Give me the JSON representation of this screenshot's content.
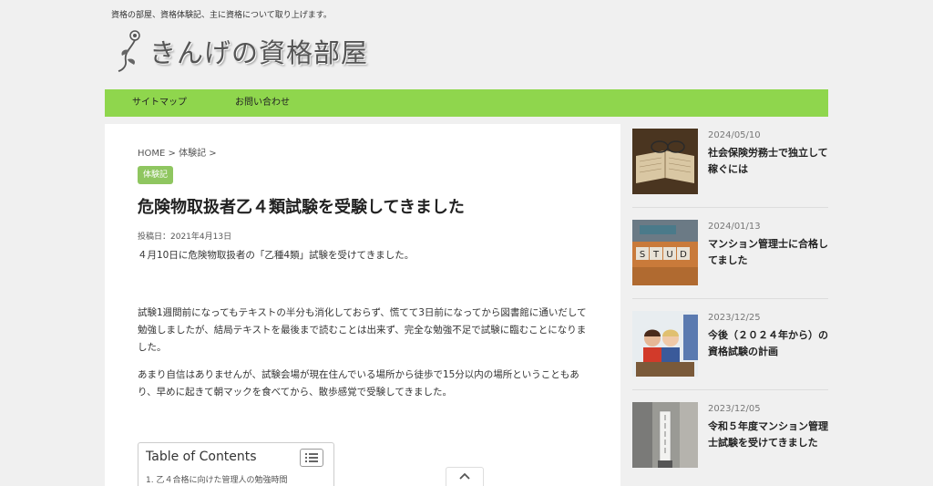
{
  "header": {
    "tagline": "資格の部屋、資格体験記、主に資格について取り上げます。",
    "site_title": "きんげの資格部屋"
  },
  "nav": {
    "items": [
      {
        "label": "サイトマップ"
      },
      {
        "label": "お問い合わせ"
      }
    ]
  },
  "article": {
    "breadcrumb": "HOME > 体験記 >",
    "category": "体験記",
    "title": "危険物取扱者乙４類試験を受験してきました",
    "date": "投稿日：2021年4月13日",
    "paragraphs": [
      "４月10日に危険物取扱者の「乙種4類」試験を受けてきました。",
      "試験1週間前になってもテキストの半分も消化しておらず、慌てて3日前になってから図書館に通いだして勉強しましたが、結局テキストを最後まで読むことは出来ず、完全な勉強不足で試験に臨むことになりました。",
      "あまり自信はありませんが、試験会場が現在住んでいる場所から徒歩で15分以内の場所ということもあり、早めに起きて朝マックを食べてから、散歩感覚で受験してきました。"
    ],
    "toc": {
      "title": "Table of Contents",
      "first_item": "1. 乙４合格に向けた管理人の勉強時間"
    }
  },
  "sidebar": {
    "posts": [
      {
        "date": "2024/05/10",
        "title": "社会保険労務士で独立して稼ぐには",
        "thumb": "book-glasses"
      },
      {
        "date": "2024/01/13",
        "title": "マンション管理士に合格してました",
        "thumb": "study-blocks"
      },
      {
        "date": "2023/12/25",
        "title": "今後（２０２４年から）の資格試験の計画",
        "thumb": "children-studying"
      },
      {
        "date": "2023/12/05",
        "title": "令和５年度マンション管理士試験を受けてきました",
        "thumb": "exam-sign"
      }
    ]
  },
  "colors": {
    "nav_green": "#8fd64d",
    "badge_green": "#8fc660",
    "background": "#f0f0f0"
  }
}
